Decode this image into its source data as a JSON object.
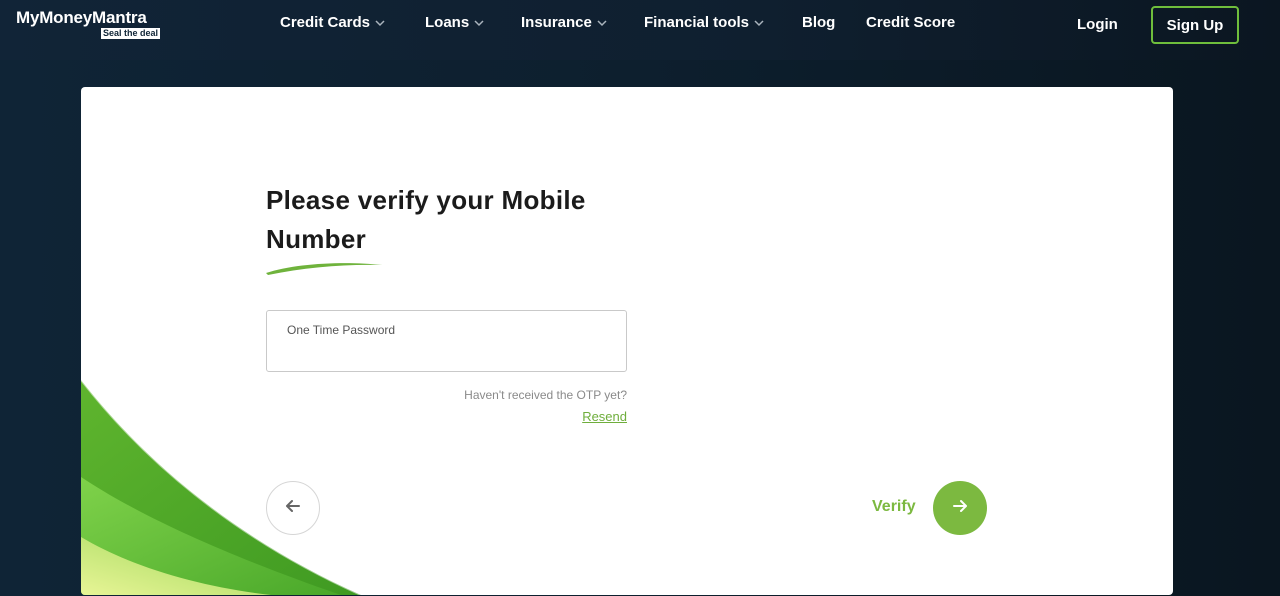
{
  "brand": {
    "name": "MyMoneyMantra",
    "tagline": "Seal the deal"
  },
  "nav": {
    "items": [
      {
        "label": "Credit Cards",
        "has_dropdown": true
      },
      {
        "label": "Loans",
        "has_dropdown": true
      },
      {
        "label": "Insurance",
        "has_dropdown": true
      },
      {
        "label": "Financial tools",
        "has_dropdown": true
      },
      {
        "label": "Blog",
        "has_dropdown": false
      },
      {
        "label": "Credit Score",
        "has_dropdown": false
      }
    ],
    "login_label": "Login",
    "signup_label": "Sign Up"
  },
  "form": {
    "heading": "Please verify your Mobile Number",
    "otp_label": "One Time Password",
    "otp_value": "",
    "resend_hint": "Haven't received the OTP yet?",
    "resend_label": "Resend",
    "verify_label": "Verify"
  },
  "icons": {
    "back": "arrow-left-icon",
    "next": "arrow-right-icon",
    "dropdown": "chevron-down-icon"
  },
  "colors": {
    "accent": "#7cb940",
    "signup_border": "#6fbe3c",
    "background": "#0f2436"
  }
}
